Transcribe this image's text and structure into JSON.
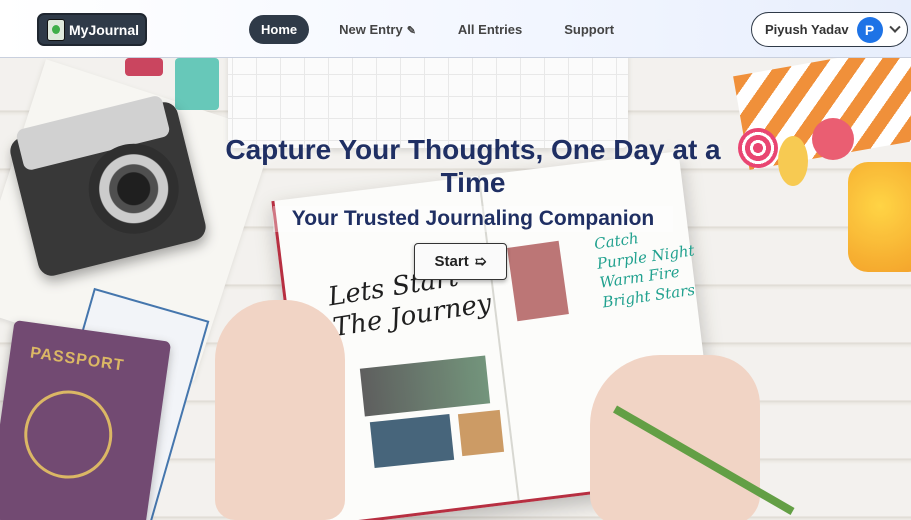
{
  "brand": {
    "name": "MyJournal",
    "icon": "journal-icon"
  },
  "nav": {
    "items": [
      {
        "label": "Home",
        "active": true
      },
      {
        "label": "New Entry",
        "icon": "pencil-icon",
        "icon_glyph": "✎"
      },
      {
        "label": "All Entries"
      },
      {
        "label": "Support"
      }
    ]
  },
  "user": {
    "name": "Piyush Yadav",
    "initial": "P",
    "avatar_color": "#1e73e6",
    "menu_icon": "chevron-down-icon"
  },
  "hero": {
    "title": "Capture Your Thoughts, One Day at a Time",
    "subtitle": "Your Trusted Journaling Companion",
    "start_label": "Start",
    "start_icon": "arrow-right-icon",
    "start_glyph": "➯"
  },
  "colors": {
    "primary_dark": "#2f3a48",
    "title_text": "#1f2f63",
    "accent": "#1e73e6"
  }
}
